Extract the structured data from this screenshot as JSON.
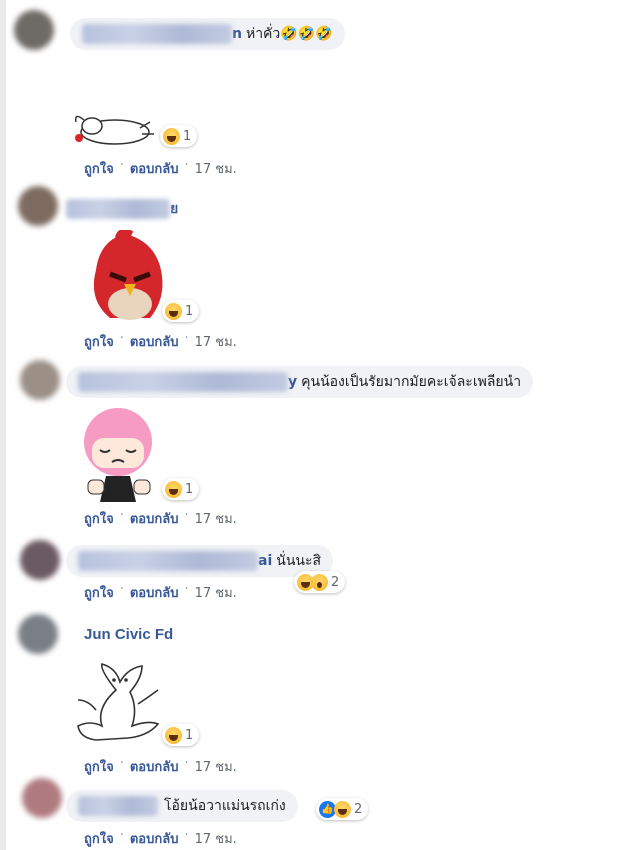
{
  "actions": {
    "like": "ถูกใจ",
    "reply": "ตอบกลับ",
    "separator": "·"
  },
  "comments": [
    {
      "name_suffix": "n",
      "text": "ห่าคั่ว🤣🤣🤣",
      "time": "17 ชม.",
      "reaction_count": "1",
      "sticker": "rabbit-sticker-icon"
    },
    {
      "name_suffix": "ย",
      "text": "",
      "time": "17 ชม.",
      "reaction_count": "1",
      "sticker": "red-bird-sticker-icon"
    },
    {
      "name_suffix": "y",
      "text": "คุนน้องเป็นรัยมากมัยคะเจ้ละเพลียนำ",
      "time": "17 ชม.",
      "reaction_count": "1",
      "sticker": "pink-hair-girl-sticker-icon"
    },
    {
      "name_suffix": "ai",
      "text": "นั่นนะสิ",
      "time": "17 ชม.",
      "reaction_count": "2"
    },
    {
      "name": "Jun Civic Fd",
      "time": "17 ชม.",
      "reaction_count": "1",
      "sticker": "white-cat-sticker-icon"
    },
    {
      "text": "โอ้ยน้อวาแม่นรถเก่ง",
      "time": "17 ชม.",
      "reaction_count": "2"
    }
  ]
}
